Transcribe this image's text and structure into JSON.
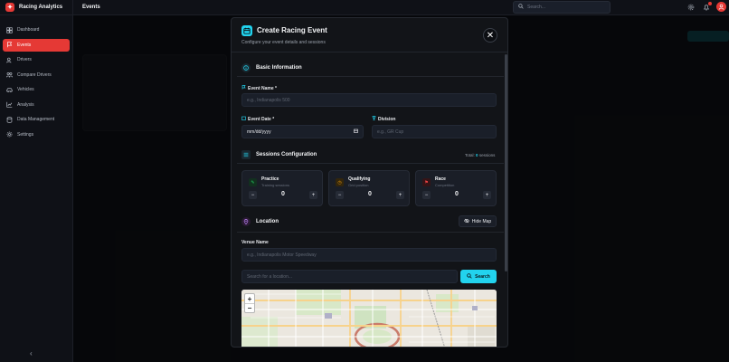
{
  "app": {
    "name": "Racing Analytics",
    "logo_glyph": "✦"
  },
  "sidebar": {
    "items": [
      {
        "label": "Dashboard",
        "icon": "dashboard-icon",
        "active": false
      },
      {
        "label": "Events",
        "icon": "flag-icon",
        "active": true
      },
      {
        "label": "Drivers",
        "icon": "users-icon",
        "active": false
      },
      {
        "label": "Compare Drivers",
        "icon": "compare-icon",
        "active": false
      },
      {
        "label": "Vehicles",
        "icon": "car-icon",
        "active": false
      },
      {
        "label": "Analysis",
        "icon": "chart-icon",
        "active": false
      },
      {
        "label": "Data Management",
        "icon": "database-icon",
        "active": false
      },
      {
        "label": "Settings",
        "icon": "gear-icon",
        "active": false
      }
    ],
    "collapse_glyph": "‹"
  },
  "topbar": {
    "title": "Events",
    "search_placeholder": "Search..."
  },
  "colors": {
    "accent_red": "#e53935",
    "accent_cyan": "#22d3ee",
    "bg": "#0c0e13"
  },
  "modal": {
    "title": "Create Racing Event",
    "subtitle": "Configure your event details and sessions",
    "close_glyph": "✕",
    "basic_info": {
      "title": "Basic Information",
      "event_name_label": "Event Name *",
      "event_name_placeholder": "e.g., Indianapolis 500",
      "event_date_label": "Event Date *",
      "event_date_value": "mm/dd/yyyy",
      "division_label": "Division",
      "division_placeholder": "e.g., GR Cup"
    },
    "sessions": {
      "title": "Sessions Configuration",
      "total_prefix": "Total:",
      "total_count": "0",
      "total_suffix": "sessions",
      "cards": [
        {
          "name": "Practice",
          "desc": "Training sessions",
          "count": "0",
          "icon": "wrench-icon",
          "color": "#22c55e"
        },
        {
          "name": "Qualifying",
          "desc": "Grid position",
          "count": "0",
          "icon": "timer-icon",
          "color": "#f59e0b"
        },
        {
          "name": "Race",
          "desc": "Competition",
          "count": "0",
          "icon": "race-flag-icon",
          "color": "#ef4444"
        }
      ]
    },
    "location": {
      "title": "Location",
      "hide_map_label": "Hide Map",
      "venue_label": "Venue Name",
      "venue_placeholder": "e.g., Indianapolis Motor Speedway",
      "search_placeholder": "Search for a location...",
      "search_button": "Search",
      "zoom_in": "+",
      "zoom_out": "−"
    }
  }
}
